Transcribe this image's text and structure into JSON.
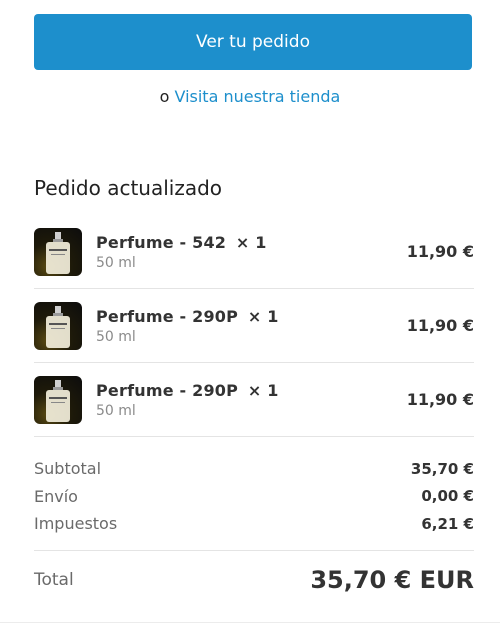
{
  "actions": {
    "view_order_label": "Ver tu pedido",
    "or_text": "o",
    "visit_store_label": "Visita nuestra tienda"
  },
  "order": {
    "title": "Pedido actualizado",
    "items": [
      {
        "name": "Perfume - 542",
        "quantity": "× 1",
        "variant": "50 ml",
        "price": "11,90 €",
        "image": "perfume-bottle-icon"
      },
      {
        "name": "Perfume - 290P",
        "quantity": "× 1",
        "variant": "50 ml",
        "price": "11,90 €",
        "image": "perfume-bottle-icon"
      },
      {
        "name": "Perfume - 290P",
        "quantity": "× 1",
        "variant": "50 ml",
        "price": "11,90 €",
        "image": "perfume-bottle-icon"
      }
    ]
  },
  "summary": {
    "subtotal_label": "Subtotal",
    "subtotal_value": "35,70 €",
    "shipping_label": "Envío",
    "shipping_value": "0,00 €",
    "taxes_label": "Impuestos",
    "taxes_value": "6,21 €",
    "total_label": "Total",
    "total_value": "35,70 € EUR"
  },
  "colors": {
    "accent": "#1d8fcc",
    "text": "#333333",
    "muted": "#8a8a8a"
  }
}
